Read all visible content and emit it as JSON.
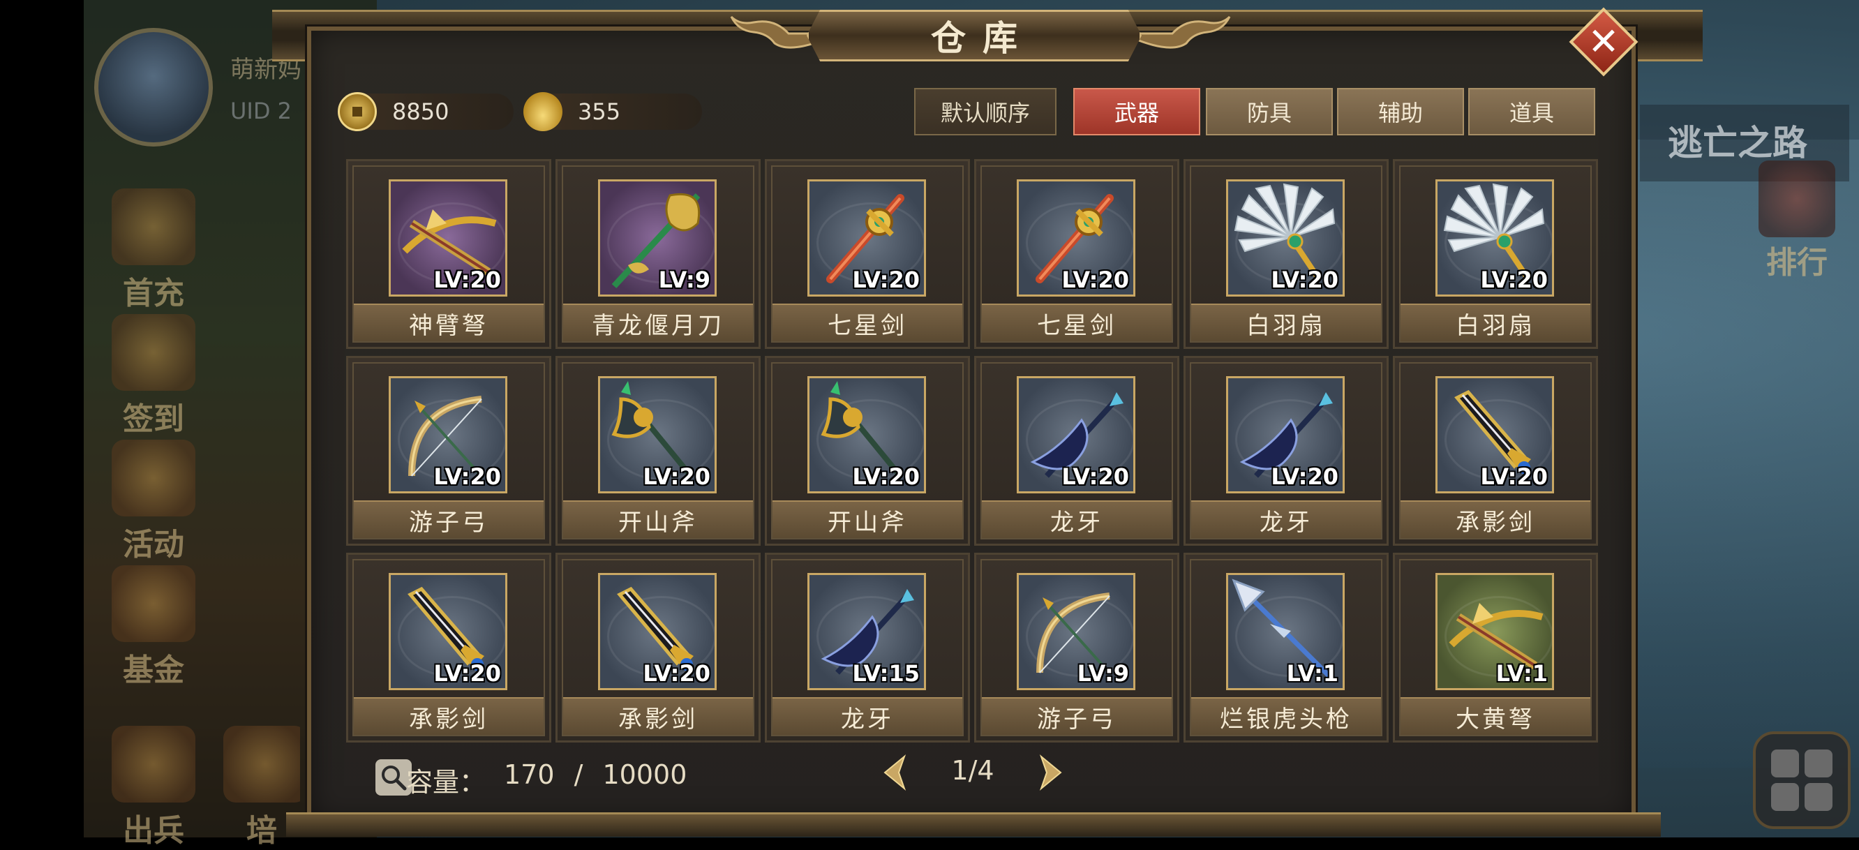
{
  "background": {
    "player_name": "萌新妈",
    "uid_label": "UID 2",
    "menu": [
      "首充",
      "签到",
      "活动",
      "基金",
      "出兵",
      "培"
    ],
    "route_title": "逃亡之路",
    "rank_label": "排行"
  },
  "window": {
    "title": "仓库",
    "close_icon": "close-icon"
  },
  "currency": {
    "coins": "8850",
    "ingots": "355"
  },
  "tabs": {
    "default_sort": "默认顺序",
    "weapons": "武器",
    "armor": "防具",
    "accessory": "辅助",
    "items": "道具",
    "active": "weapons"
  },
  "items": [
    {
      "name": "神臂弩",
      "level": "LV:20",
      "icon": "crossbow-icon",
      "rarity": "purple"
    },
    {
      "name": "青龙偃月刀",
      "level": "LV:9",
      "icon": "glaive-icon",
      "rarity": "purple"
    },
    {
      "name": "七星剑",
      "level": "LV:20",
      "icon": "sword-icon",
      "rarity": "blue"
    },
    {
      "name": "七星剑",
      "level": "LV:20",
      "icon": "sword-icon",
      "rarity": "blue"
    },
    {
      "name": "白羽扇",
      "level": "LV:20",
      "icon": "feather-fan-icon",
      "rarity": "blue"
    },
    {
      "name": "白羽扇",
      "level": "LV:20",
      "icon": "feather-fan-icon",
      "rarity": "blue"
    },
    {
      "name": "游子弓",
      "level": "LV:20",
      "icon": "bow-icon",
      "rarity": "blue"
    },
    {
      "name": "开山斧",
      "level": "LV:20",
      "icon": "axe-icon",
      "rarity": "blue"
    },
    {
      "name": "开山斧",
      "level": "LV:20",
      "icon": "axe-icon",
      "rarity": "blue"
    },
    {
      "name": "龙牙",
      "level": "LV:20",
      "icon": "halberd-icon",
      "rarity": "blue"
    },
    {
      "name": "龙牙",
      "level": "LV:20",
      "icon": "halberd-icon",
      "rarity": "blue"
    },
    {
      "name": "承影剑",
      "level": "LV:20",
      "icon": "broadsword-icon",
      "rarity": "blue"
    },
    {
      "name": "承影剑",
      "level": "LV:20",
      "icon": "broadsword-icon",
      "rarity": "blue"
    },
    {
      "name": "承影剑",
      "level": "LV:20",
      "icon": "broadsword-icon",
      "rarity": "blue"
    },
    {
      "name": "龙牙",
      "level": "LV:15",
      "icon": "halberd-icon",
      "rarity": "blue"
    },
    {
      "name": "游子弓",
      "level": "LV:9",
      "icon": "bow-icon",
      "rarity": "blue"
    },
    {
      "name": "烂银虎头枪",
      "level": "LV:1",
      "icon": "spear-icon",
      "rarity": "blue"
    },
    {
      "name": "大黄弩",
      "level": "LV:1",
      "icon": "crossbow-icon",
      "rarity": "green"
    }
  ],
  "footer": {
    "capacity_label": "容量：",
    "capacity_value": "170 / 10000",
    "page": "1/4"
  }
}
